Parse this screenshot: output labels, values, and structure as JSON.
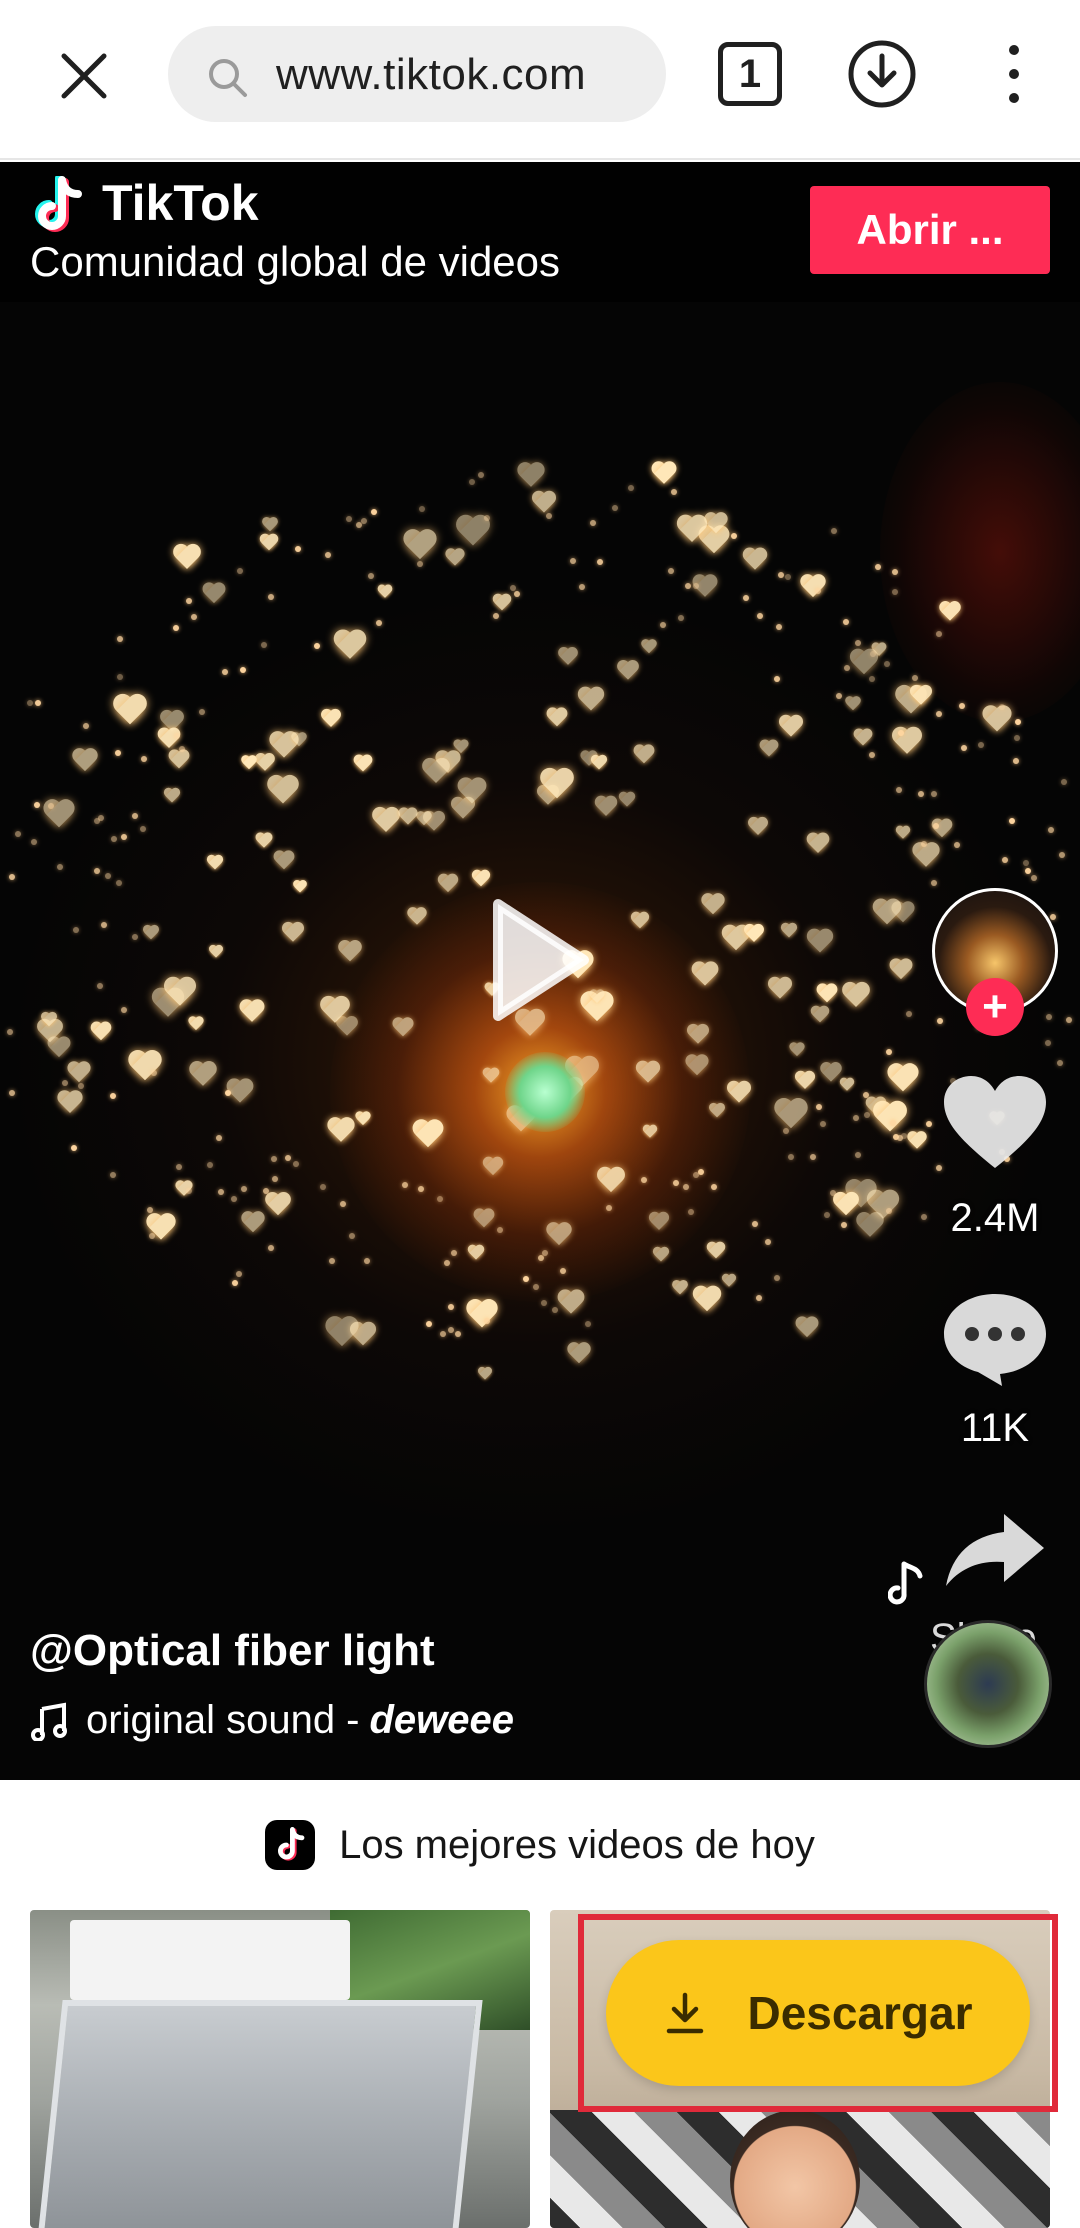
{
  "browser": {
    "url": "www.tiktok.com",
    "tab_count": "1"
  },
  "banner": {
    "brand": "TikTok",
    "tagline": "Comunidad global de videos",
    "open_button": "Abrir ..."
  },
  "video": {
    "likes": "2.4M",
    "comments": "11K",
    "share_label": "Share",
    "username": "@Optical fiber light",
    "sound_prefix": "original sound -",
    "sound_author": "deweee"
  },
  "feed": {
    "section_title": "Los mejores videos de hoy",
    "download_button": "Descargar"
  },
  "colors": {
    "tiktok_red": "#fe2c55",
    "download_yellow": "#fbc61a",
    "highlight_red": "#e02a3a"
  },
  "icons": {
    "close": "close-icon",
    "search": "search-icon",
    "download": "download-icon",
    "menu": "more-vert-icon",
    "play": "play-icon",
    "heart": "heart-icon",
    "comment": "comment-icon",
    "share": "share-icon",
    "music": "music-note-icon"
  }
}
